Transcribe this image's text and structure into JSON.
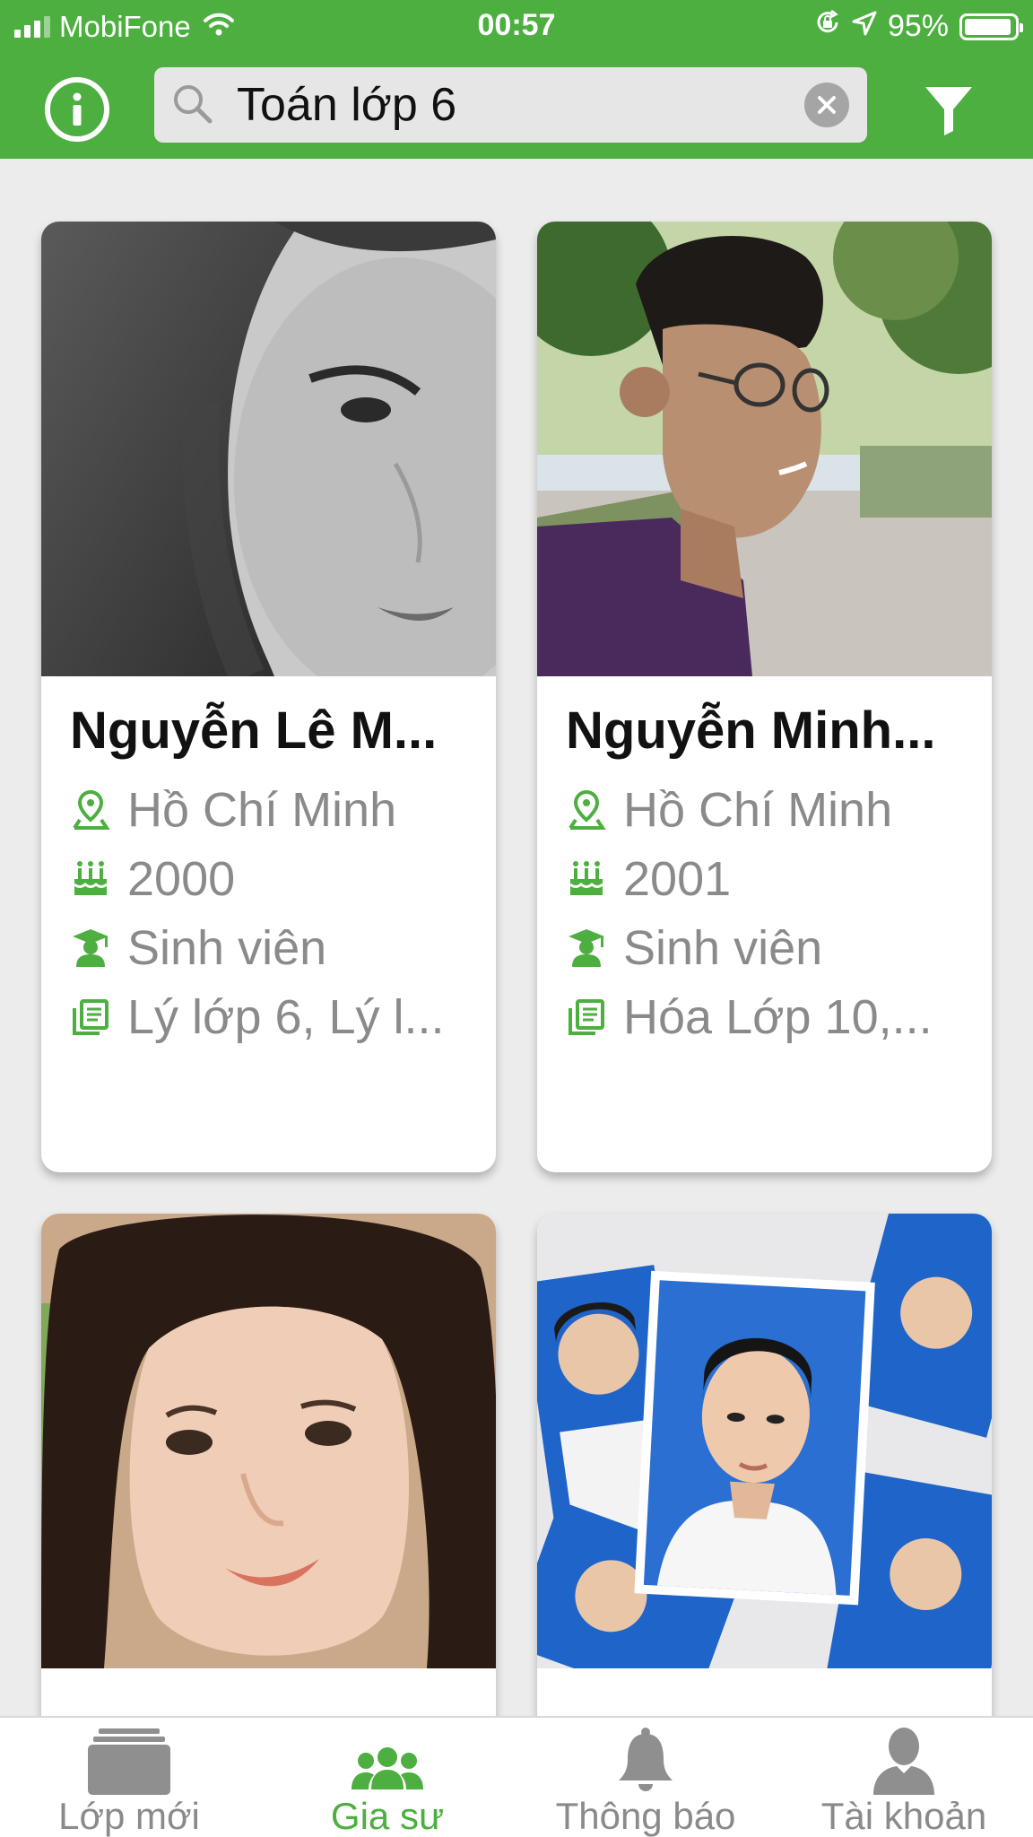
{
  "status_bar": {
    "carrier": "MobiFone",
    "time": "00:57",
    "battery": "95%",
    "battery_level": 0.95
  },
  "header": {
    "info_icon": "info-circle-icon",
    "search_value": "Toán lớp 6",
    "search_icon": "search-icon",
    "clear_icon": "clear-icon",
    "filter_icon": "filter-icon"
  },
  "tutors": [
    {
      "name": "Nguyễn Lê M...",
      "location": "Hồ Chí Minh",
      "birth_year": "2000",
      "occupation": "Sinh viên",
      "subjects": "Lý lớp 6, Lý l..."
    },
    {
      "name": "Nguyễn Minh...",
      "location": "Hồ Chí Minh",
      "birth_year": "2001",
      "occupation": "Sinh viên",
      "subjects": "Hóa Lớp 10,..."
    },
    {
      "name": "",
      "location": "",
      "birth_year": "",
      "occupation": "",
      "subjects": ""
    },
    {
      "name": "",
      "location": "",
      "birth_year": "",
      "occupation": "",
      "subjects": ""
    }
  ],
  "tabs": [
    {
      "label": "Lớp mới",
      "icon": "classes-icon",
      "active": false
    },
    {
      "label": "Gia sư",
      "icon": "tutors-icon",
      "active": true
    },
    {
      "label": "Thông báo",
      "icon": "bell-icon",
      "active": false
    },
    {
      "label": "Tài khoản",
      "icon": "account-icon",
      "active": false
    }
  ],
  "colors": {
    "brand_green": "#4caf3f",
    "text_gray": "#8a8a8a",
    "background": "#ececec"
  }
}
